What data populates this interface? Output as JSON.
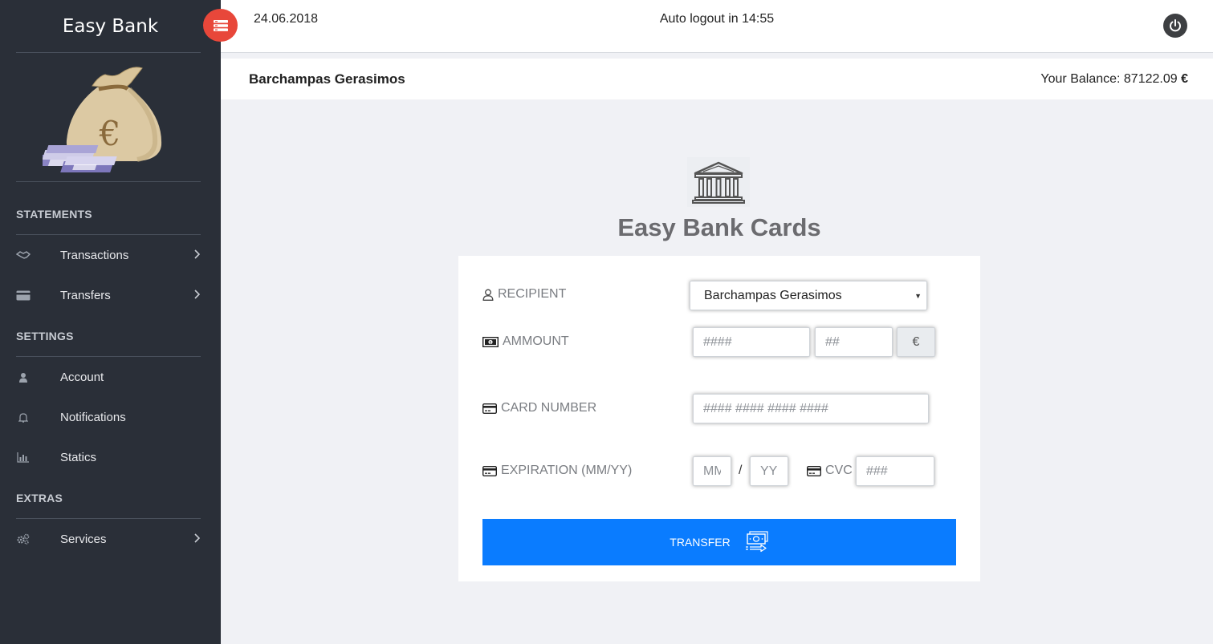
{
  "app": {
    "brand": "Easy Bank"
  },
  "topbar": {
    "date": "24.06.2018",
    "logout_text": "Auto logout in 14:55"
  },
  "userbar": {
    "name": "Barchampas Gerasimos",
    "balance_label": "Your Balance: 87122.09",
    "currency": "€"
  },
  "sidebar": {
    "sections": [
      {
        "title": "STATEMENTS",
        "items": [
          {
            "label": "Transactions",
            "icon": "handshake-icon",
            "has_chevron": true
          },
          {
            "label": "Transfers",
            "icon": "credit-card-icon",
            "has_chevron": true
          }
        ]
      },
      {
        "title": "SETTINGS",
        "items": [
          {
            "label": "Account",
            "icon": "user-icon",
            "has_chevron": false
          },
          {
            "label": "Notifications",
            "icon": "bell-icon",
            "has_chevron": false
          },
          {
            "label": "Statics",
            "icon": "bar-chart-icon",
            "has_chevron": false
          }
        ]
      },
      {
        "title": "EXTRAS",
        "items": [
          {
            "label": "Services",
            "icon": "gears-icon",
            "has_chevron": true
          }
        ]
      }
    ]
  },
  "main": {
    "title": "Easy Bank Cards",
    "form": {
      "recipient_label": "RECIPIENT",
      "recipient_value": "Barchampas Gerasimos",
      "amount_label": "AMMOUNT",
      "amount_whole_placeholder": "####",
      "amount_cents_placeholder": "##",
      "amount_currency": "€",
      "card_label": "CARD NUMBER",
      "card_placeholder": "#### #### #### ####",
      "expiration_label": "EXPIRATION (MM/YY)",
      "month_placeholder": "MM",
      "separator": "/",
      "year_placeholder": "YY",
      "cvc_label": "CVC",
      "cvc_placeholder": "###",
      "submit_label": "TRANSFER"
    }
  },
  "colors": {
    "sidebar_bg": "#2a2f38",
    "accent_red": "#e8473a",
    "primary_blue": "#0a7cff",
    "page_bg": "#f0f1f5"
  }
}
